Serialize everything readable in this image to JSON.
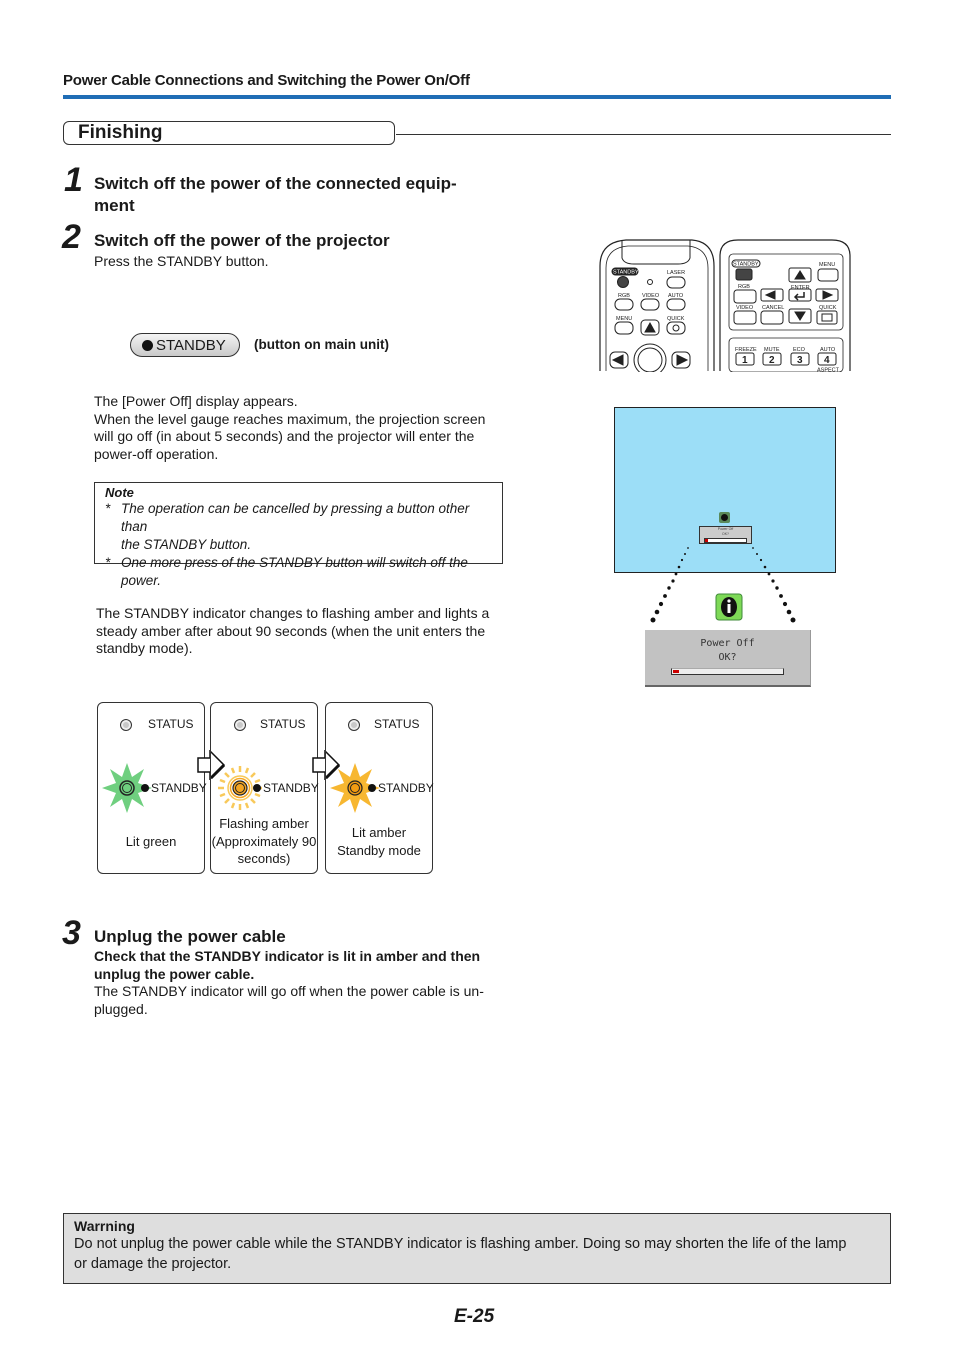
{
  "header": {
    "section_title": "Power Cable Connections and Switching the Power On/Off",
    "accent_color": "#1f6db5"
  },
  "subsection": {
    "title": "Finishing"
  },
  "steps": [
    {
      "number": "1",
      "title_line1": "Switch off the power of the connected equip-",
      "title_line2": "ment"
    },
    {
      "number": "2",
      "title": "Switch off the power of the projector",
      "instruction": "Press the STANDBY button.",
      "button_label": "STANDBY",
      "button_caption": "(button on main unit)",
      "para1_line1": "The [Power Off] display appears.",
      "para1_line2": "When the level gauge reaches maximum, the projection screen",
      "para1_line3": "will go off (in about 5 seconds) and the projector will enter the",
      "para1_line4": "power-off operation.",
      "note": {
        "title": "Note",
        "items": [
          {
            "star": "*",
            "line1": "The operation can be cancelled by pressing a button other than",
            "line2": "the STANDBY button."
          },
          {
            "star": "*",
            "line1": "One more press of the STANDBY button will switch off the power."
          }
        ]
      },
      "para2_line1": "The STANDBY indicator changes to flashing amber and lights a",
      "para2_line2": "steady amber after about 90 seconds (when the unit enters the",
      "para2_line3": "standby mode)."
    },
    {
      "number": "3",
      "title": "Unplug the power cable",
      "bold_line1": "Check that the STANDBY indicator is lit in amber and then",
      "bold_line2": "unplug the power cable.",
      "text_line1": "The STANDBY indicator will go off when the power cable is un-",
      "text_line2": "plugged."
    }
  ],
  "indicator_panels": [
    {
      "status": "STATUS",
      "standby": "STANDBY",
      "caption": [
        "Lit green"
      ],
      "color": "#6fcf7f"
    },
    {
      "status": "STATUS",
      "standby": "STANDBY",
      "caption": [
        "Flashing amber",
        "(Approximately 90",
        "seconds)"
      ],
      "color": "#f5a623"
    },
    {
      "status": "STATUS",
      "standby": "STANDBY",
      "caption": [
        "Lit amber",
        "Standby mode"
      ],
      "color": "#f5a623"
    }
  ],
  "remote_small": {
    "labels": {
      "standby": "STANDBY",
      "laser": "LASER",
      "rgb": "RGB",
      "video": "VIDEO",
      "auto": "AUTO",
      "menu": "MENU",
      "quick": "QUICK"
    }
  },
  "remote_large": {
    "labels": {
      "standby": "STANDBY",
      "menu": "MENU",
      "rgb": "RGB",
      "enter": "ENTER",
      "video": "VIDEO",
      "cancel": "CANCEL",
      "quick": "QUICK",
      "freeze": "FREEZE",
      "mute": "MUTE",
      "eco": "ECO",
      "auto": "AUTO",
      "aspect": "ASPECT",
      "n1": "1",
      "n2": "2",
      "n3": "3",
      "n4": "4"
    }
  },
  "osd": {
    "line1": "Power Off",
    "line2": "OK?",
    "gauge_fraction": 0.05,
    "gauge_color": "#cc0000",
    "screen_color": "#9cdef7",
    "info_icon_color": "#7ed957"
  },
  "warning": {
    "title": "Warrning",
    "line1": "Do not unplug the power cable while the STANDBY indicator is flashing amber. Doing so may shorten the life of the lamp",
    "line2": "or damage the projector."
  },
  "footer": {
    "page_number": "E-25"
  }
}
